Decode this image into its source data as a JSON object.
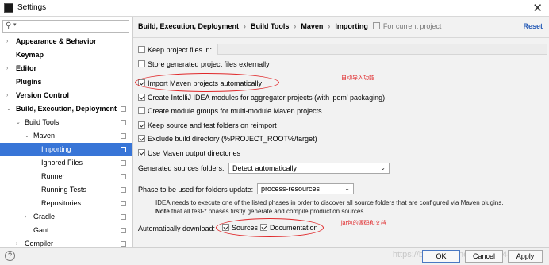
{
  "window": {
    "title": "Settings"
  },
  "search": {
    "placeholder": ""
  },
  "sidebar": {
    "items": [
      {
        "label": "Appearance & Behavior",
        "bold": true,
        "arrow": "›"
      },
      {
        "label": "Keymap",
        "bold": true,
        "arrow": ""
      },
      {
        "label": "Editor",
        "bold": true,
        "arrow": "›"
      },
      {
        "label": "Plugins",
        "bold": true,
        "arrow": ""
      },
      {
        "label": "Version Control",
        "bold": true,
        "arrow": "›"
      },
      {
        "label": "Build, Execution, Deployment",
        "bold": true,
        "arrow": "⌄"
      },
      {
        "label": "Build Tools",
        "bold": false,
        "arrow": "⌄"
      },
      {
        "label": "Maven",
        "bold": false,
        "arrow": "⌄"
      },
      {
        "label": "Importing",
        "bold": false,
        "arrow": "",
        "selected": true
      },
      {
        "label": "Ignored Files",
        "bold": false,
        "arrow": ""
      },
      {
        "label": "Runner",
        "bold": false,
        "arrow": ""
      },
      {
        "label": "Running Tests",
        "bold": false,
        "arrow": ""
      },
      {
        "label": "Repositories",
        "bold": false,
        "arrow": ""
      },
      {
        "label": "Gradle",
        "bold": false,
        "arrow": "›"
      },
      {
        "label": "Gant",
        "bold": false,
        "arrow": ""
      },
      {
        "label": "Compiler",
        "bold": false,
        "arrow": "›"
      }
    ]
  },
  "breadcrumb": {
    "items": [
      "Build, Execution, Deployment",
      "Build Tools",
      "Maven",
      "Importing"
    ],
    "separator": "›",
    "for_current_project": "For current project"
  },
  "reset_label": "Reset",
  "options": {
    "keep_project_files": {
      "label": "Keep project files in:",
      "checked": false
    },
    "store_generated": {
      "label": "Store generated project files externally",
      "checked": false
    },
    "import_automatically": {
      "label": "Import Maven projects automatically",
      "checked": true
    },
    "create_intellij_modules": {
      "label": "Create IntelliJ IDEA modules for aggregator projects (with 'pom' packaging)",
      "checked": true
    },
    "create_module_groups": {
      "label": "Create module groups for multi-module Maven projects",
      "checked": false
    },
    "keep_source_folders": {
      "label": "Keep source and test folders on reimport",
      "checked": true
    },
    "exclude_build_dir": {
      "label": "Exclude build directory (%PROJECT_ROOT%/target)",
      "checked": true
    },
    "use_maven_output": {
      "label": "Use Maven output directories",
      "checked": true
    }
  },
  "generated_sources": {
    "label": "Generated sources folders:",
    "value": "Detect automatically"
  },
  "phase": {
    "label": "Phase to be used for folders update:",
    "value": "process-resources"
  },
  "phase_note": {
    "line1": "IDEA needs to execute one of the listed phases in order to discover all source folders that are configured via Maven plugins.",
    "note_bold": "Note",
    "line2": " that all test-* phases firstly generate and compile production sources."
  },
  "auto_download": {
    "label": "Automatically download:",
    "sources": {
      "label": "Sources",
      "checked": true
    },
    "documentation": {
      "label": "Documentation",
      "checked": true
    }
  },
  "annotations": {
    "auto_import": "自动导入功能",
    "jar_sources": "jar包的源码和文档",
    "color": "#e0282a"
  },
  "buttons": {
    "ok": "OK",
    "cancel": "Cancel",
    "apply": "Apply",
    "help": "?"
  },
  "watermark": "https://blog.csdn.net/weixin_44048682",
  "colors": {
    "selection": "#3875d7",
    "link": "#2b5fb8"
  }
}
